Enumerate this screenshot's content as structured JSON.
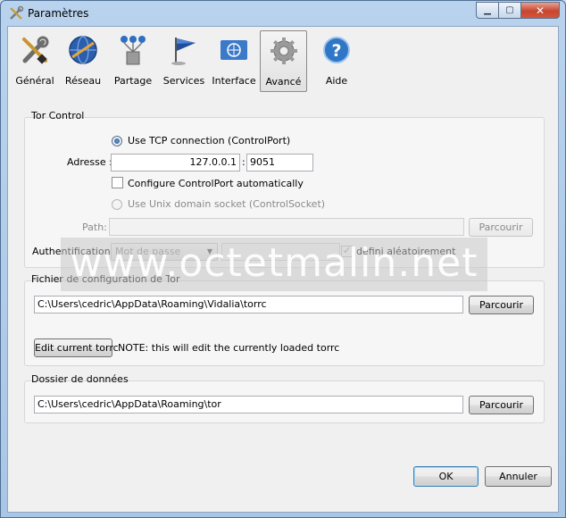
{
  "window": {
    "title": "Paramètres"
  },
  "toolbar": {
    "items": [
      {
        "label": "Général",
        "icon": "tools-icon"
      },
      {
        "label": "Réseau",
        "icon": "network-globe-icon"
      },
      {
        "label": "Partage",
        "icon": "sharing-icon"
      },
      {
        "label": "Services",
        "icon": "flag-icon"
      },
      {
        "label": "Interface",
        "icon": "un-flag-icon"
      },
      {
        "label": "Avancé",
        "icon": "gear-icon",
        "selected": true
      },
      {
        "label": "Aide",
        "icon": "help-icon"
      }
    ]
  },
  "tor_control": {
    "title": "Tor Control",
    "use_tcp_label": "Use TCP connection (ControlPort)",
    "address_label": "Adresse :",
    "address_value": "127.0.0.1",
    "port_sep": ":",
    "port_value": "9051",
    "configure_auto_label": "Configure ControlPort automatically",
    "unix_socket_label": "Use Unix domain socket (ControlSocket)",
    "path_label": "Path:",
    "path_value": "",
    "path_browse": "Parcourir",
    "auth_label": "Authentification :",
    "auth_selected": "Mot de passe",
    "password_value": "",
    "random_label": "défini aléatoirement",
    "random_mark": "✓"
  },
  "torrc": {
    "title": "Fichier de configuration de Tor",
    "path_value": "C:\\Users\\cedric\\AppData\\Roaming\\Vidalia\\torrc",
    "browse": "Parcourir",
    "edit_button": "Edit current torrc",
    "note": "NOTE: this will edit the currently loaded torrc"
  },
  "data_dir": {
    "title": "Dossier de données",
    "path_value": "C:\\Users\\cedric\\AppData\\Roaming\\tor",
    "browse": "Parcourir"
  },
  "footer": {
    "ok": "OK",
    "cancel": "Annuler"
  },
  "watermark": "www.octetmalin.net",
  "colors": {
    "titlebar": "#b9d3ee",
    "close": "#c8452f",
    "panel": "#f0f0f0"
  }
}
